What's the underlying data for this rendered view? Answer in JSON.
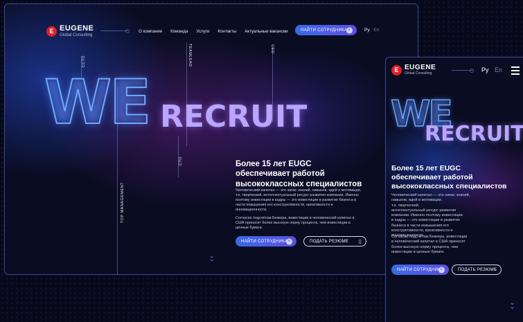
{
  "brand": {
    "mark": "E",
    "name": "EUGENE",
    "sub": "Global Consulting"
  },
  "nav": {
    "items": [
      "О компании",
      "Команда",
      "Услуги",
      "Контакты",
      "Актуальные вакансии"
    ]
  },
  "header": {
    "cta_label": "НАЙТИ СОТРУДНИКА"
  },
  "lang": {
    "ru": "Ру",
    "sep": "·",
    "en": "En"
  },
  "hero": {
    "we": "WE",
    "recruit": "RECRUIT",
    "roles": {
      "ccto": "CCTO",
      "teamlead": "TEAMLEAD",
      "ceo": "CEO",
      "cto": "CTO",
      "top_management": "TOP MANAGEMENT"
    },
    "headline": [
      "Более 15 лет EUGC",
      "обеспечивает работой",
      "высококлассных специалистов"
    ],
    "para1": [
      "Человеческий капитал — это запас знаний, навыков, идей и мотивации,",
      "т.е. творческий, интеллектуальный ресурс развития компании. Именно",
      "поэтому инвестиции в кадры — это инвестиции в развитие бизнеса в",
      "части повышения его конструктивности, креативности и",
      "инновационности."
    ],
    "para2": [
      "Согласно подсчётам Беккера, инвестиции в человеческий капитал в",
      "США приносят более высокую норму процента, чем инвестиции в",
      "ценные бумаги."
    ],
    "btn_find": "НАЙТИ СОТРУДНИКА",
    "btn_resume": "ПОДАТЬ РЕЗЮМЕ"
  },
  "mobile": {
    "lang_ru": "Ру",
    "lang_en": "En",
    "headline": [
      "Более 15 лет EUGC",
      "обеспечивает работой",
      "высококлассных специалистов"
    ],
    "para1": [
      "Человеческий капитал — это запас знаний,",
      "навыков, идей и мотивации,",
      "т.е. творческий,",
      "интеллектуальный ресурс развития",
      "компании. Именно поэтому инвестиции",
      "в кадры — это инвестиции в развитие",
      "бизнеса в части повышения его",
      "конструктивности, креативности и",
      "инновационности."
    ],
    "para2": [
      "Согласно подсчётам Беккера, инвестиции",
      "в человеческий капитал в США приносят",
      "более высокую норму процента, чем",
      "инвестиции в ценные бумаги."
    ],
    "btn_find": "НАЙТИ СОТРУДНИКА",
    "btn_resume": "ПОДАТЬ РЕЗЮМЕ"
  },
  "colors": {
    "accent": "#3a6ae6",
    "brand_red": "#e01e2a",
    "bg": "#07091a",
    "recruit_gradient": [
      "#a78bff",
      "#5fc8ff"
    ]
  },
  "icons": {
    "cta": "chevrons-icon",
    "resume": "document-icon",
    "scroll": "double-chevron-down-icon",
    "menu": "hamburger-icon"
  }
}
